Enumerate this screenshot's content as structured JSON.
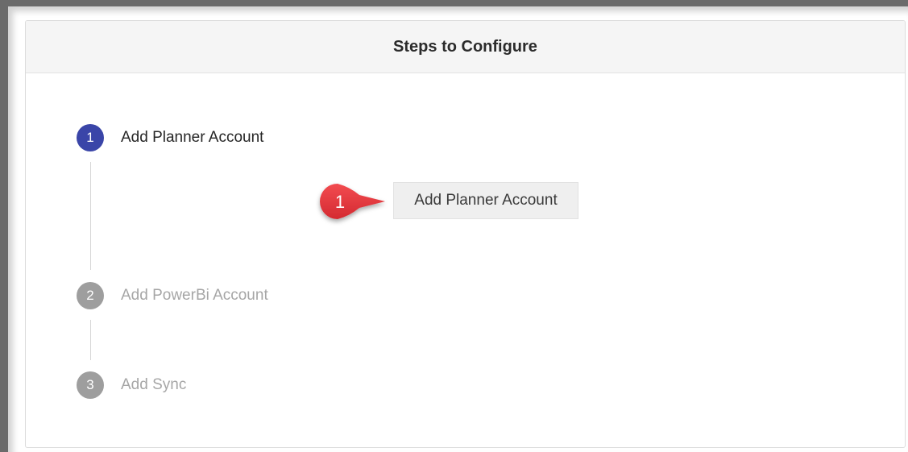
{
  "panel": {
    "title": "Steps to Configure"
  },
  "steps": [
    {
      "number": "1",
      "label": "Add Planner Account",
      "state": "active"
    },
    {
      "number": "2",
      "label": "Add PowerBi Account",
      "state": "inactive"
    },
    {
      "number": "3",
      "label": "Add Sync",
      "state": "inactive"
    }
  ],
  "step1_action": {
    "button_label": "Add Planner Account"
  },
  "callout": {
    "number": "1",
    "color": "#e8373e"
  },
  "colors": {
    "active_step": "#3a45a8",
    "inactive_step": "#9e9e9e"
  }
}
